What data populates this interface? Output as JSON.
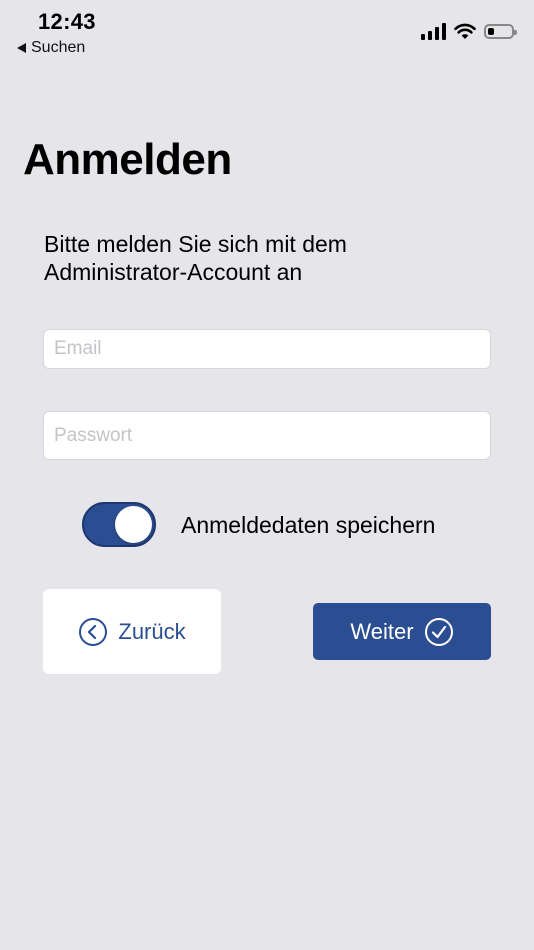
{
  "status_bar": {
    "time": "12:43",
    "back_app": "Suchen",
    "icons": [
      "signal-icon",
      "wifi-icon",
      "battery-icon"
    ]
  },
  "page": {
    "title": "Anmelden",
    "instructions": "Bitte melden Sie sich mit dem Administrator-Account an"
  },
  "form": {
    "email": {
      "placeholder": "Email",
      "value": ""
    },
    "password": {
      "placeholder": "Passwort",
      "value": ""
    },
    "remember": {
      "label": "Anmeldedaten speichern",
      "checked": true
    }
  },
  "buttons": {
    "back_label": "Zurück",
    "next_label": "Weiter"
  },
  "colors": {
    "background": "#e6e5ea",
    "accent": "#2a4e91",
    "surface": "#ffffff"
  }
}
